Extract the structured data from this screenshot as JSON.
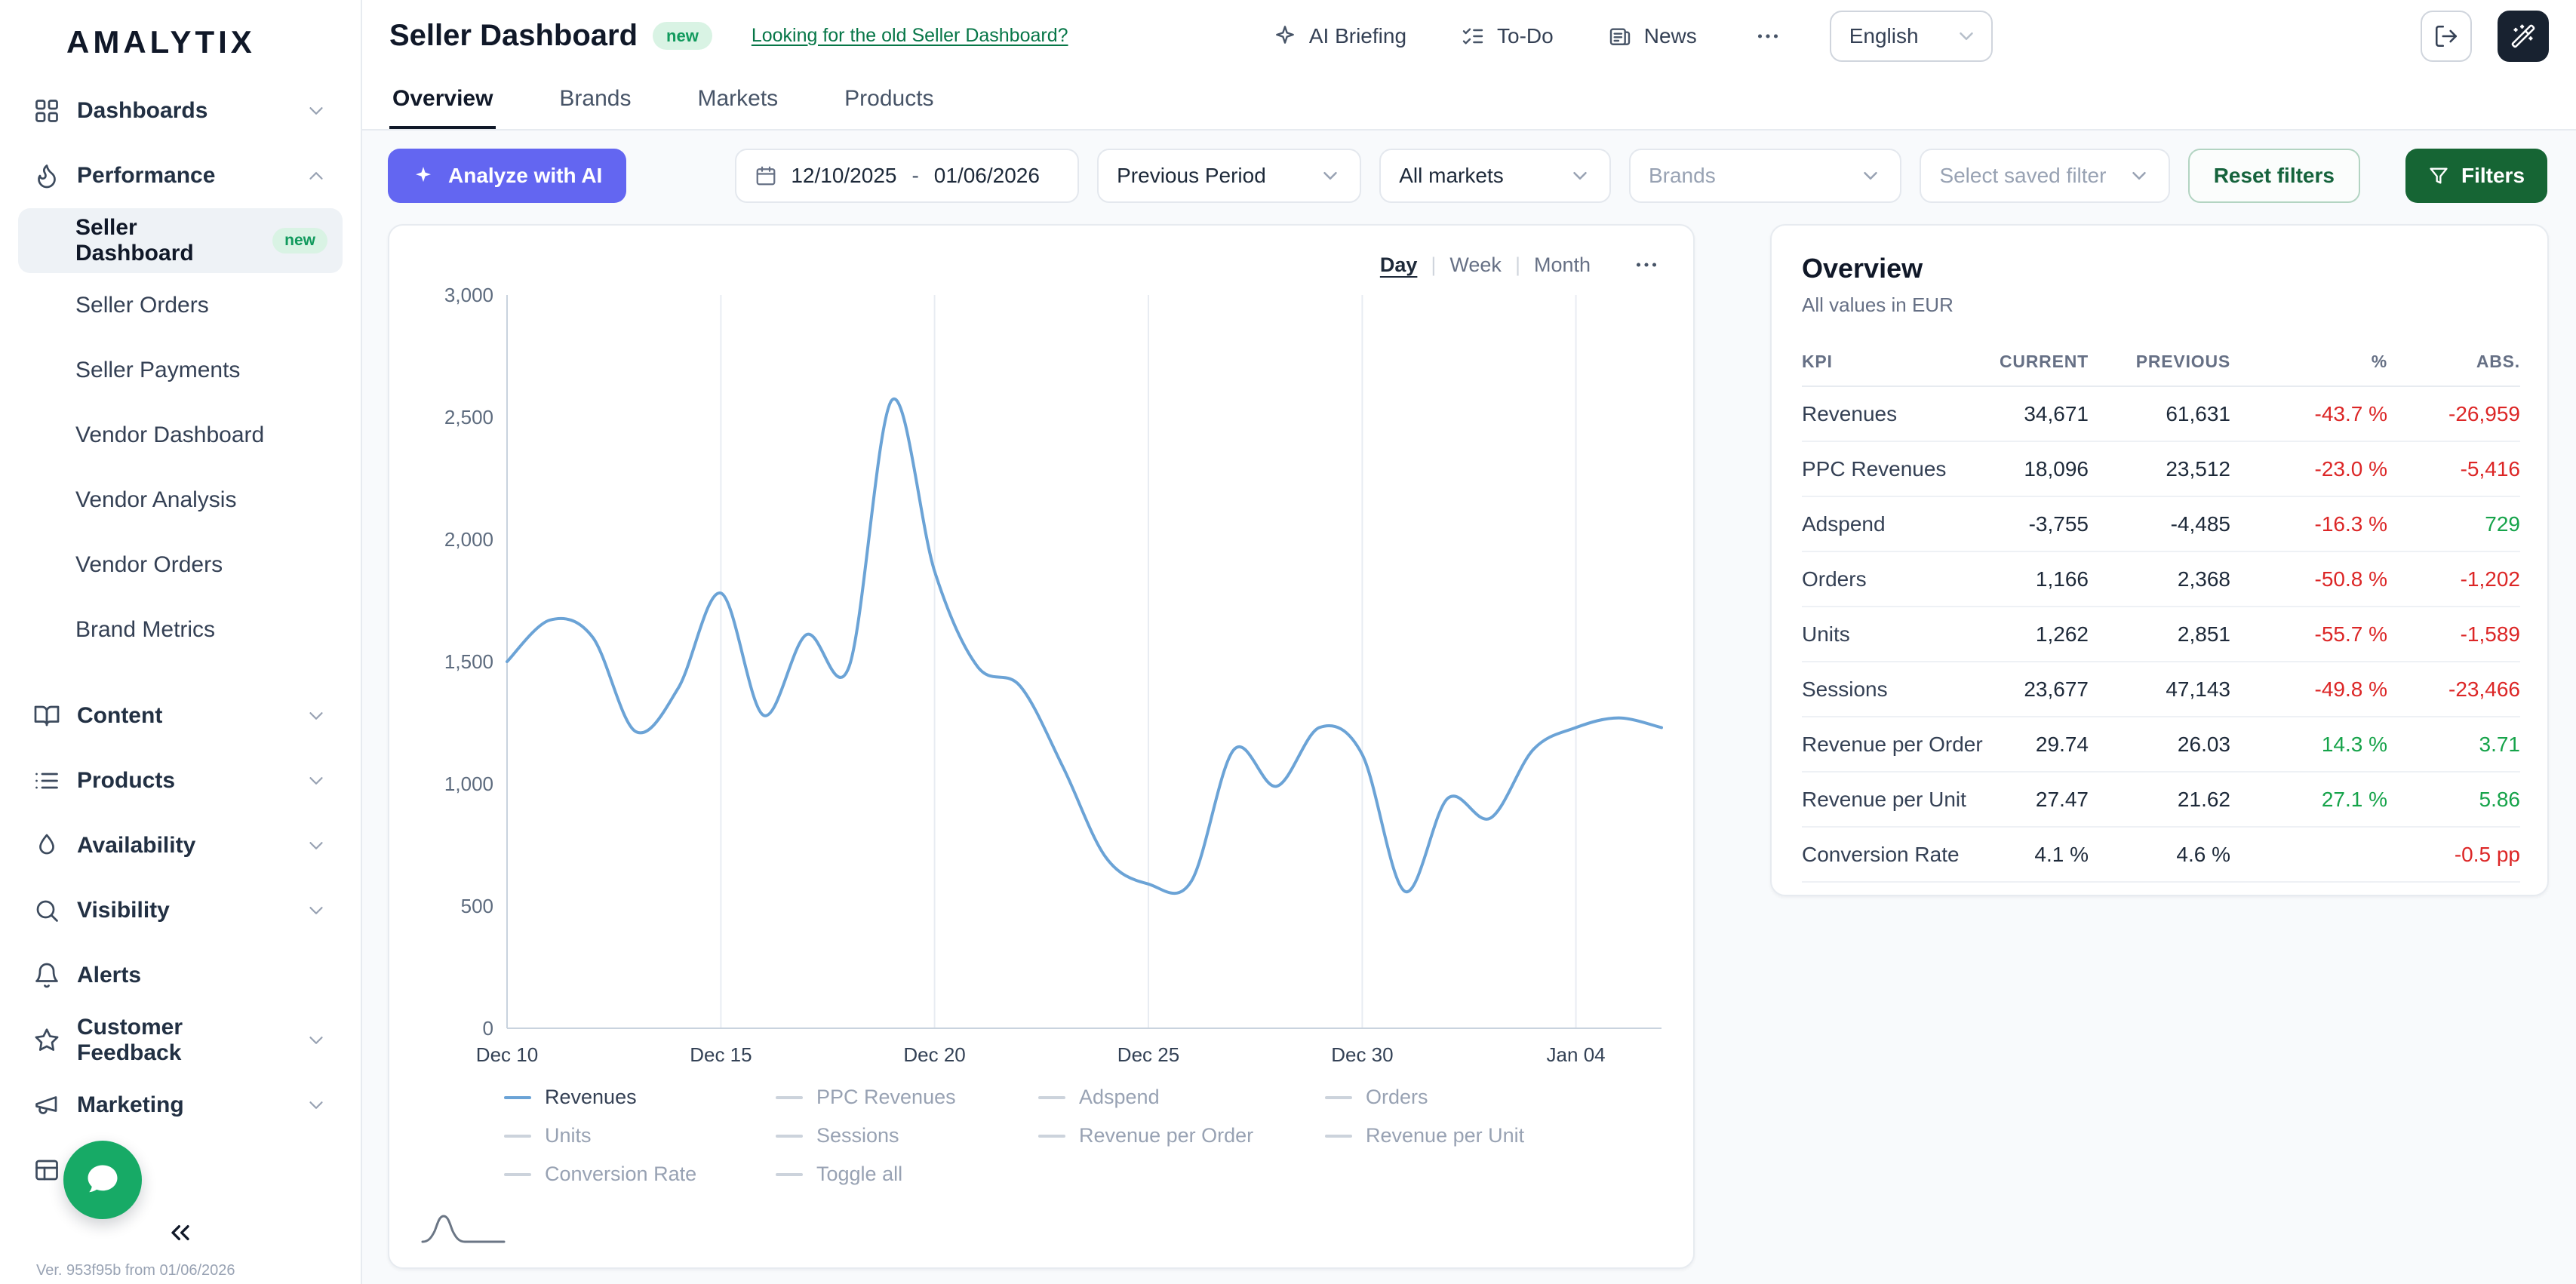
{
  "brand": {
    "logo": "AMALYTIX"
  },
  "sidebar": {
    "items": [
      {
        "label": "Dashboards",
        "icon": "grid",
        "chevron": "down"
      },
      {
        "label": "Performance",
        "icon": "flame",
        "chevron": "up",
        "children": [
          {
            "label": "Seller Dashboard",
            "badge": "new",
            "selected": true
          },
          {
            "label": "Seller Orders"
          },
          {
            "label": "Seller Payments"
          },
          {
            "label": "Vendor Dashboard"
          },
          {
            "label": "Vendor Analysis"
          },
          {
            "label": "Vendor Orders"
          },
          {
            "label": "Brand Metrics"
          }
        ]
      },
      {
        "label": "Content",
        "icon": "book",
        "chevron": "down",
        "spaced": true
      },
      {
        "label": "Products",
        "icon": "list",
        "chevron": "down"
      },
      {
        "label": "Availability",
        "icon": "droplet",
        "chevron": "down"
      },
      {
        "label": "Visibility",
        "icon": "search",
        "chevron": "down"
      },
      {
        "label": "Alerts",
        "icon": "bell"
      },
      {
        "label": "Customer Feedback",
        "icon": "star",
        "chevron": "down"
      },
      {
        "label": "Marketing",
        "icon": "megaphone",
        "chevron": "down"
      },
      {
        "label": "",
        "icon": "table"
      }
    ],
    "version": "Ver. 953f95b from 01/06/2026"
  },
  "header": {
    "title": "Seller Dashboard",
    "badge": "new",
    "old_link": "Looking for the old Seller Dashboard?",
    "menu": [
      {
        "label": "AI Briefing",
        "icon": "sparkle"
      },
      {
        "label": "To-Do",
        "icon": "checklist"
      },
      {
        "label": "News",
        "icon": "news"
      }
    ],
    "language": "English"
  },
  "tabs": [
    {
      "label": "Overview",
      "active": true
    },
    {
      "label": "Brands"
    },
    {
      "label": "Markets"
    },
    {
      "label": "Products"
    }
  ],
  "filters": {
    "analyze_ai": "Analyze with AI",
    "date_start": "12/10/2025",
    "date_separator": "-",
    "date_end": "01/06/2026",
    "compare": "Previous Period",
    "markets": "All markets",
    "brands_placeholder": "Brands",
    "saved_filter_placeholder": "Select saved filter",
    "reset_label": "Reset filters",
    "filters_label": "Filters"
  },
  "chart_card": {
    "granularity": [
      "Day",
      "Week",
      "Month"
    ],
    "granularity_active": "Day",
    "legend": [
      {
        "label": "Revenues",
        "active": true
      },
      {
        "label": "PPC Revenues"
      },
      {
        "label": "Adspend"
      },
      {
        "label": "Orders"
      },
      {
        "label": "Units"
      },
      {
        "label": "Sessions"
      },
      {
        "label": "Revenue per Order"
      },
      {
        "label": "Revenue per Unit"
      },
      {
        "label": "Conversion Rate"
      },
      {
        "label": "Toggle all"
      }
    ]
  },
  "chart_data": {
    "type": "line",
    "series": [
      {
        "name": "Revenues",
        "color": "#6ba3d6",
        "values": [
          1500,
          1670,
          1600,
          1215,
          1390,
          1780,
          1280,
          1610,
          1480,
          2570,
          1870,
          1480,
          1400,
          1070,
          700,
          590,
          600,
          1140,
          990,
          1230,
          1120,
          560,
          940,
          860,
          1140,
          1230,
          1270,
          1230
        ]
      }
    ],
    "x_labels": [
      "Dec 10",
      "Dec 11",
      "Dec 12",
      "Dec 13",
      "Dec 14",
      "Dec 15",
      "Dec 16",
      "Dec 17",
      "Dec 18",
      "Dec 19",
      "Dec 20",
      "Dec 21",
      "Dec 22",
      "Dec 23",
      "Dec 24",
      "Dec 25",
      "Dec 26",
      "Dec 27",
      "Dec 28",
      "Dec 29",
      "Dec 30",
      "Dec 31",
      "Jan 01",
      "Jan 02",
      "Jan 03",
      "Jan 04",
      "Jan 05",
      "Jan 06"
    ],
    "x_tick_indices": [
      0,
      5,
      10,
      15,
      20,
      25
    ],
    "ylim": [
      0,
      3000
    ],
    "y_ticks": [
      0,
      500,
      1000,
      1500,
      2000,
      2500,
      3000
    ],
    "grid": "vertical",
    "legend_position": "bottom"
  },
  "kpi_panel": {
    "title": "Overview",
    "subtitle": "All values in EUR",
    "columns": [
      "KPI",
      "CURRENT",
      "PREVIOUS",
      "%",
      "ABS."
    ],
    "rows": [
      {
        "kpi": "Revenues",
        "current": "34,671",
        "previous": "61,631",
        "pct": "-43.7 %",
        "pct_tone": "neg",
        "abs": "-26,959",
        "abs_tone": "neg"
      },
      {
        "kpi": "PPC Revenues",
        "current": "18,096",
        "previous": "23,512",
        "pct": "-23.0 %",
        "pct_tone": "neg",
        "abs": "-5,416",
        "abs_tone": "neg"
      },
      {
        "kpi": "Adspend",
        "current": "-3,755",
        "previous": "-4,485",
        "pct": "-16.3 %",
        "pct_tone": "neg",
        "abs": "729",
        "abs_tone": "pos"
      },
      {
        "kpi": "Orders",
        "current": "1,166",
        "previous": "2,368",
        "pct": "-50.8 %",
        "pct_tone": "neg",
        "abs": "-1,202",
        "abs_tone": "neg"
      },
      {
        "kpi": "Units",
        "current": "1,262",
        "previous": "2,851",
        "pct": "-55.7 %",
        "pct_tone": "neg",
        "abs": "-1,589",
        "abs_tone": "neg"
      },
      {
        "kpi": "Sessions",
        "current": "23,677",
        "previous": "47,143",
        "pct": "-49.8 %",
        "pct_tone": "neg",
        "abs": "-23,466",
        "abs_tone": "neg"
      },
      {
        "kpi": "Revenue per Order",
        "current": "29.74",
        "previous": "26.03",
        "pct": "14.3 %",
        "pct_tone": "pos",
        "abs": "3.71",
        "abs_tone": "pos"
      },
      {
        "kpi": "Revenue per Unit",
        "current": "27.47",
        "previous": "21.62",
        "pct": "27.1 %",
        "pct_tone": "pos",
        "abs": "5.86",
        "abs_tone": "pos"
      },
      {
        "kpi": "Conversion Rate",
        "current": "4.1 %",
        "previous": "4.6 %",
        "pct": "",
        "pct_tone": "",
        "abs": "-0.5 pp",
        "abs_tone": "neg"
      }
    ]
  },
  "colors": {
    "accent_green": "#166534",
    "ai_purple": "#6366f1",
    "line_blue": "#6ba3d6",
    "negative": "#dc2626",
    "positive": "#16a34a",
    "chat_green": "#17aa66"
  }
}
